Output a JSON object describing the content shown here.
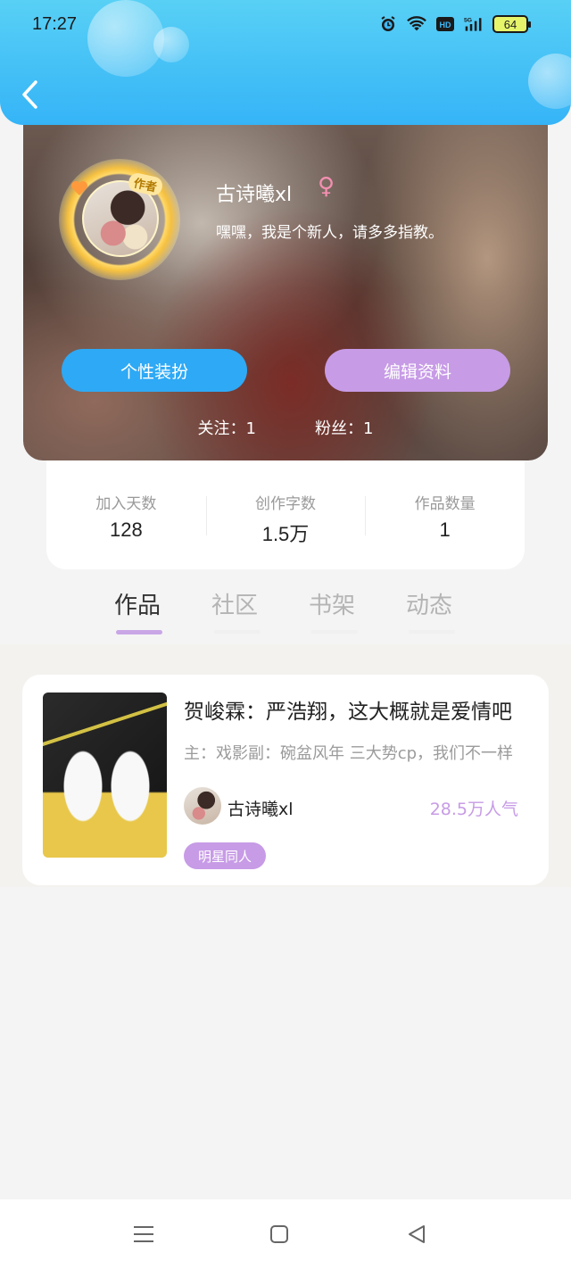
{
  "status_bar": {
    "time": "17:27",
    "network_label": "5G",
    "hd_label": "HD",
    "battery": "64",
    "icons": [
      "alarm-icon",
      "wifi-icon",
      "hd-icon",
      "signal-icon",
      "battery-icon"
    ]
  },
  "profile": {
    "badge": "作者",
    "username": "古诗曦xl",
    "gender_symbol": "♀",
    "bio": "嘿嘿，我是个新人，请多多指教。",
    "dress_button": "个性装扮",
    "edit_button": "编辑资料",
    "following": "关注：1",
    "followers": "粉丝：1"
  },
  "stats": [
    {
      "label": "加入天数",
      "value": "128"
    },
    {
      "label": "创作字数",
      "value": "1.5万"
    },
    {
      "label": "作品数量",
      "value": "1"
    }
  ],
  "tabs": [
    {
      "label": "作品",
      "active": true
    },
    {
      "label": "社区",
      "active": false
    },
    {
      "label": "书架",
      "active": false
    },
    {
      "label": "动态",
      "active": false
    }
  ],
  "works": [
    {
      "title": "贺峻霖：严浩翔，这大概就是爱情吧",
      "description": "主：戏影副：碗盆风年  三大势cp，我们不一样",
      "author": "古诗曦xl",
      "popularity": "28.5万人气",
      "tag": "明星同人"
    }
  ],
  "colors": {
    "header_blue": "#35b4f7",
    "dress_button": "#2ea9f5",
    "edit_button": "#c79be6",
    "accent_purple": "#c79be6",
    "gender_pink": "#f48fb1"
  },
  "nav_icons": [
    "menu-icon",
    "home-square-icon",
    "back-triangle-icon"
  ]
}
